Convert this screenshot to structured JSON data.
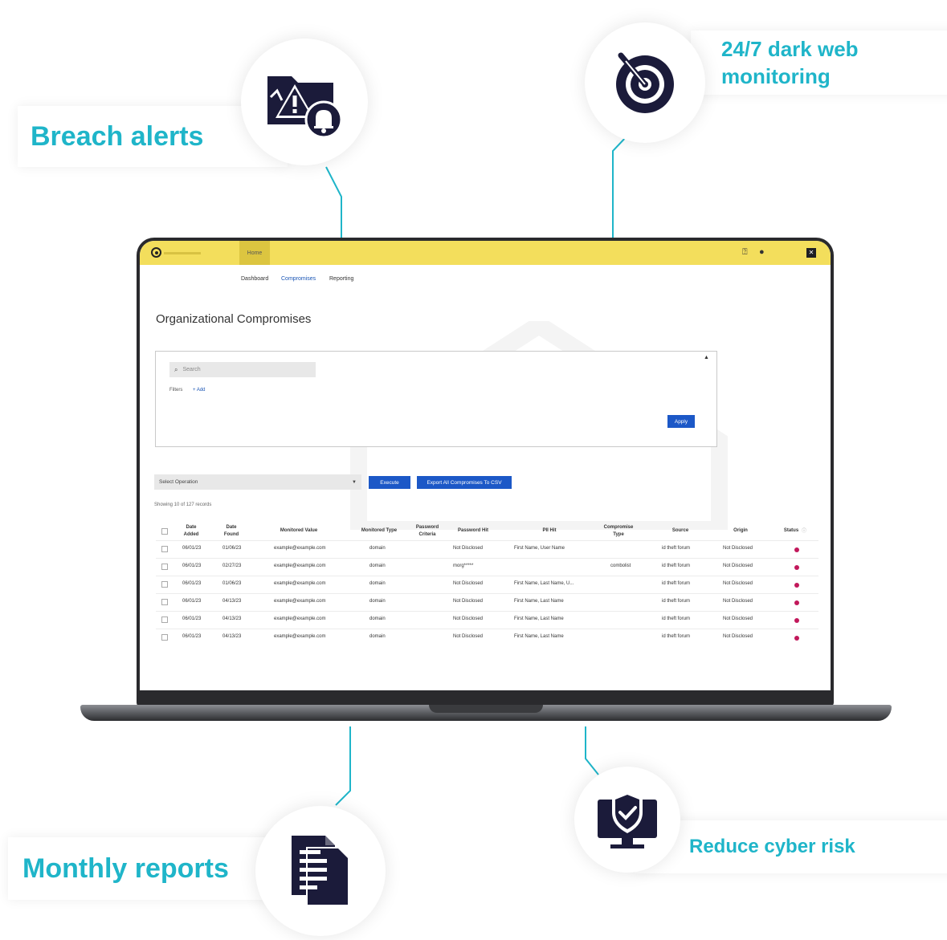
{
  "features": {
    "breach_alerts": "Breach alerts",
    "dark_web_line1": "24/7 dark web",
    "dark_web_line2": "monitoring",
    "monthly_reports": "Monthly reports",
    "reduce_cyber_risk": "Reduce cyber risk"
  },
  "icons": {
    "breach": "folder-warning-bell-icon",
    "radar": "radar-icon",
    "reports": "documents-icon",
    "risk": "monitor-shield-icon"
  },
  "colors": {
    "accent": "#1fb5c9",
    "icon_navy": "#1b1b3a",
    "topbar_yellow": "#f3de5c",
    "primary_button": "#1c58c7",
    "status_red": "#c2185b"
  },
  "app": {
    "home_tab": "Home",
    "tabs": [
      "Dashboard",
      "Compromises",
      "Reporting"
    ],
    "page_title": "Organizational Compromises",
    "search_placeholder": "Search",
    "filters_label": "Filters",
    "filters_add": "+ Add",
    "apply_button": "Apply",
    "select_operation": "Select Operation",
    "execute_button": "Execute",
    "export_button": "Export All Compromises To CSV",
    "showing_text": "Showing 10 of 127 records",
    "columns": [
      "Date Added",
      "Date Found",
      "Monitored Value",
      "Monitored Type",
      "Password Criteria",
      "Password Hit",
      "PII Hit",
      "Compromise Type",
      "Source",
      "Origin",
      "Status"
    ],
    "rows": [
      [
        "06/01/23",
        "01/06/23",
        "example@example.com",
        "domain",
        "",
        "Not Disclosed",
        "First Name, User Name",
        "",
        "id theft forum",
        "Not Disclosed"
      ],
      [
        "06/01/23",
        "02/27/23",
        "example@example.com",
        "domain",
        "",
        "morg*****",
        "",
        "combolist",
        "id theft forum",
        "Not Disclosed"
      ],
      [
        "06/01/23",
        "01/06/23",
        "example@example.com",
        "domain",
        "",
        "Not Disclosed",
        "First Name, Last Name, U...",
        "",
        "id theft forum",
        "Not Disclosed"
      ],
      [
        "06/01/23",
        "04/13/23",
        "example@example.com",
        "domain",
        "",
        "Not Disclosed",
        "First Name, Last Name",
        "",
        "id theft forum",
        "Not Disclosed"
      ],
      [
        "06/01/23",
        "04/13/23",
        "example@example.com",
        "domain",
        "",
        "Not Disclosed",
        "First Name, Last Name",
        "",
        "id theft forum",
        "Not Disclosed"
      ],
      [
        "06/01/23",
        "04/13/23",
        "example@example.com",
        "domain",
        "",
        "Not Disclosed",
        "First Name, Last Name",
        "",
        "id theft forum",
        "Not Disclosed"
      ]
    ]
  }
}
